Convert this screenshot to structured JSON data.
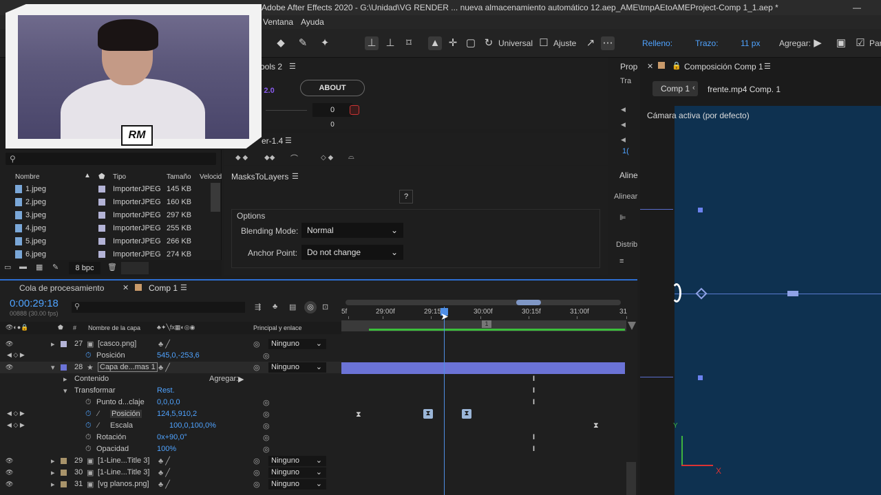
{
  "window": {
    "title": "Adobe After Effects 2020 - G:\\Unidad\\VG RENDER ... nueva almacenamiento automático 12.aep_AME\\tmpAEtoAMEProject-Comp 1_1.aep *"
  },
  "menu": {
    "items": [
      "Ventana",
      "Ayuda"
    ]
  },
  "toolbar": {
    "universal_label": "Universal",
    "ajuste_label": "Ajuste",
    "relleno_label": "Relleno:",
    "trazo_label": "Trazo:",
    "stroke_width": "11 px",
    "agregar_label": "Agregar:",
    "overflow_label": "Par"
  },
  "panels": {
    "tools_title": "ools 2",
    "tools_version": "v. 2.0",
    "about_label": "ABOUT",
    "tools_value1": "0",
    "tools_value2": "0",
    "ease_title": "er-1.4",
    "props_title": "Prop",
    "props_tab2": "Tra",
    "props_num": "1(",
    "align_title": "Aline",
    "align_label": "Alinear",
    "distrib_label": "Distrib"
  },
  "m2l": {
    "title": "MasksToLayers",
    "help": "?",
    "options_label": "Options",
    "blending_label": "Blending Mode:",
    "blending_value": "Normal",
    "anchor_label": "Anchor Point:",
    "anchor_value": "Do not change"
  },
  "project": {
    "search_placeholder": "",
    "headers": {
      "name": "Nombre",
      "type": "Tipo",
      "size": "Tamaño",
      "speed": "Velocid"
    },
    "files": [
      {
        "name": "1.jpeg",
        "type": "ImporterJPEG",
        "size": "145 KB"
      },
      {
        "name": "2.jpeg",
        "type": "ImporterJPEG",
        "size": "160 KB"
      },
      {
        "name": "3.jpeg",
        "type": "ImporterJPEG",
        "size": "297 KB"
      },
      {
        "name": "4.jpeg",
        "type": "ImporterJPEG",
        "size": "255 KB"
      },
      {
        "name": "5.jpeg",
        "type": "ImporterJPEG",
        "size": "266 KB"
      },
      {
        "name": "6.jpeg",
        "type": "ImporterJPEG",
        "size": "274 KB"
      }
    ],
    "bpc": "8 bpc"
  },
  "viewer": {
    "comp_tab": "Composición Comp 1",
    "breadcrumb_1": "Comp 1",
    "breadcrumb_2": "frente.mp4 Comp. 1",
    "camera": "Cámara activa (por defecto)",
    "axis_y": "Y",
    "axis_x": "X"
  },
  "timeline": {
    "tab_queue": "Cola de procesamiento",
    "tab_comp": "Comp 1",
    "timecode": "0:00:29:18",
    "fps": "00888 (30.00 fps)",
    "col_layer": "Nombre de la capa",
    "col_parent": "Principal y enlace",
    "ruler": [
      "5f",
      "29:00f",
      "29:15f",
      "30:00f",
      "30:15f",
      "31:00f",
      "31"
    ],
    "marker": "1",
    "rows": [
      {
        "num": "27",
        "name": "[casco.png]",
        "parent": "Ninguno"
      },
      {
        "prop": "Posición",
        "value": "545,0,-253,6"
      },
      {
        "num": "28",
        "name": "Capa de...mas 1",
        "parent": "Ninguno"
      },
      {
        "group": "Contenido",
        "agregar": "Agregar:"
      },
      {
        "group": "Transformar",
        "reset": "Rest."
      },
      {
        "prop": "Punto d...claje",
        "value": "0,0,0,0"
      },
      {
        "prop": "Posición",
        "value": "124,5,910,2"
      },
      {
        "prop": "Escala",
        "value": "100,0,100,0%"
      },
      {
        "prop": "Rotación",
        "value": "0x+90,0°"
      },
      {
        "prop": "Opacidad",
        "value": "100%"
      },
      {
        "num": "29",
        "name": "[1-Line...Title 3]",
        "parent": "Ninguno"
      },
      {
        "num": "30",
        "name": "[1-Line...Title 3]",
        "parent": "Ninguno"
      },
      {
        "num": "31",
        "name": "[vg planos.png]",
        "parent": "Ninguno"
      }
    ]
  },
  "colors": {
    "accent": "#2d6fd3",
    "blue_value": "#4fa3ff",
    "layer_bar": "#6b73d6",
    "canvas": "#0e3150"
  }
}
